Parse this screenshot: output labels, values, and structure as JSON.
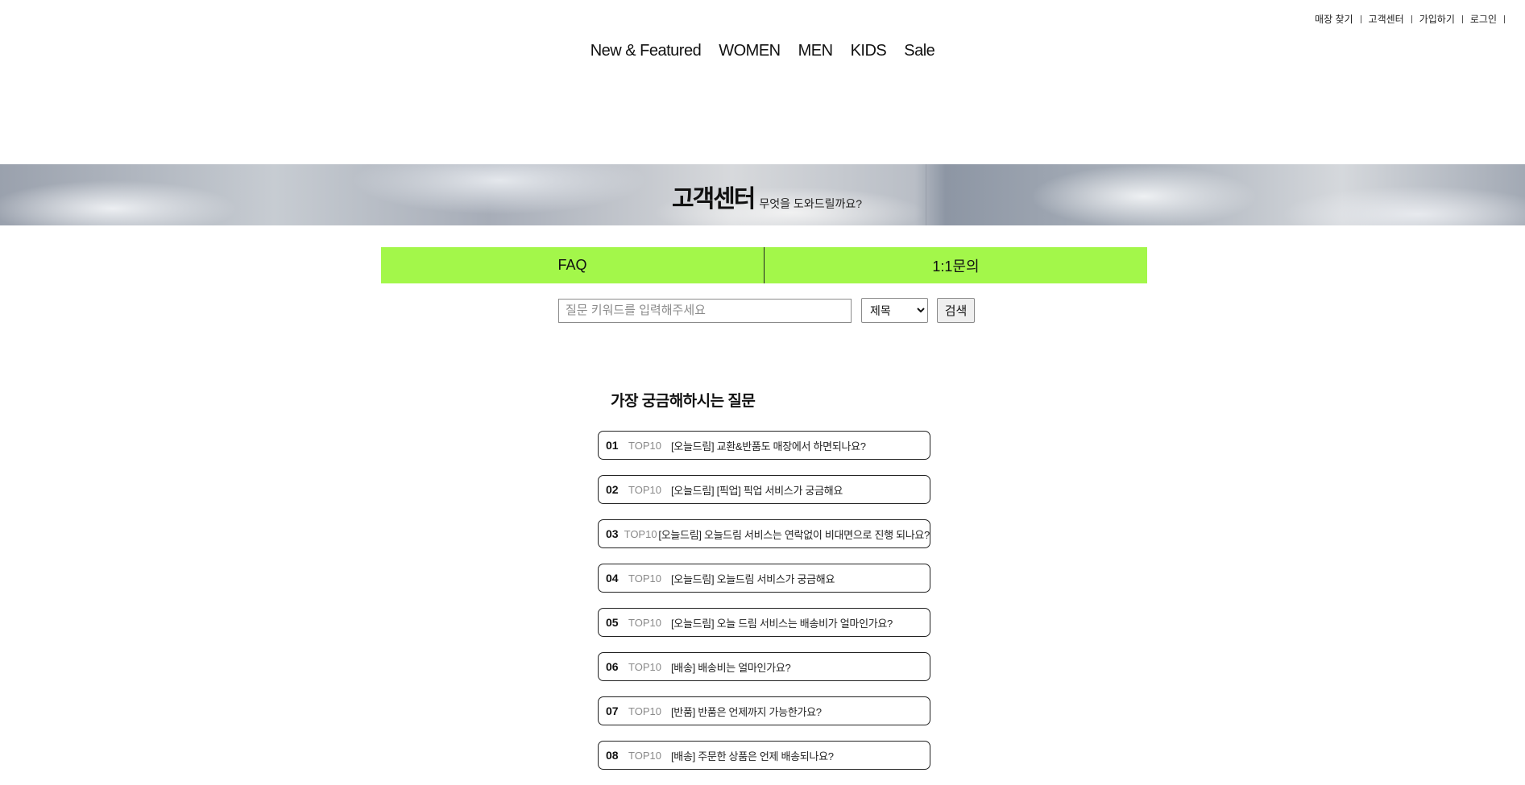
{
  "util_nav": {
    "items": [
      {
        "label": "매장 찾기"
      },
      {
        "label": "고객센터"
      },
      {
        "label": "가입하기"
      },
      {
        "label": "로그인"
      }
    ]
  },
  "main_nav": {
    "items": [
      {
        "label": "New & Featured"
      },
      {
        "label": "WOMEN"
      },
      {
        "label": "MEN"
      },
      {
        "label": "KIDS"
      },
      {
        "label": "Sale"
      }
    ]
  },
  "hero": {
    "title": "고객센터",
    "subtitle": "무엇을 도와드릴까요?"
  },
  "tabs": [
    {
      "label": "FAQ"
    },
    {
      "label": "1:1문의"
    }
  ],
  "search": {
    "placeholder": "질문 키워드를 입력해주세요",
    "select_value": "제목",
    "button_label": "검색"
  },
  "faq": {
    "heading": "가장 궁금해하시는 질문",
    "items": [
      {
        "num": "01",
        "badge": "TOP10",
        "text": "[오늘드림] 교환&반품도 매장에서 하면되나요?"
      },
      {
        "num": "02",
        "badge": "TOP10",
        "text": "[오늘드림] [픽업] 픽업 서비스가 궁금해요"
      },
      {
        "num": "03",
        "badge": "TOP10",
        "text": "[오늘드림] 오늘드림 서비스는 연락없이 비대면으로 진행 되나요?"
      },
      {
        "num": "04",
        "badge": "TOP10",
        "text": "[오늘드림] 오늘드림 서비스가 궁금해요"
      },
      {
        "num": "05",
        "badge": "TOP10",
        "text": "[오늘드림] 오늘 드림 서비스는 배송비가 얼마인가요?"
      },
      {
        "num": "06",
        "badge": "TOP10",
        "text": "[배송] 배송비는 얼마인가요?"
      },
      {
        "num": "07",
        "badge": "TOP10",
        "text": "[반품] 반품은 언제까지 가능한가요?"
      },
      {
        "num": "08",
        "badge": "TOP10",
        "text": "[배송] 주문한 상품은 언제 배송되나요?"
      }
    ]
  },
  "colors": {
    "tab_background": "#a3f74a",
    "badge_text": "#8a8a8a"
  }
}
